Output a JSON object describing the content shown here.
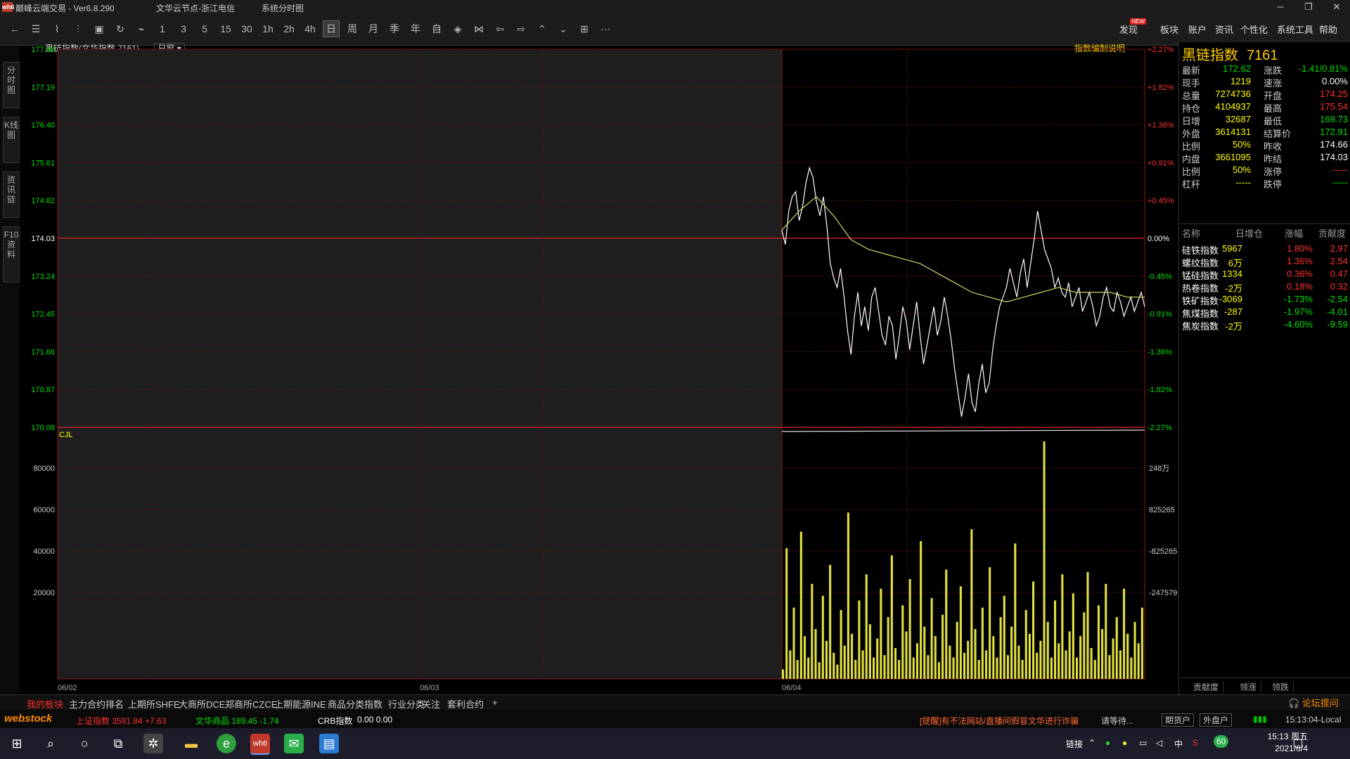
{
  "window": {
    "app_title": "巅峰云端交易 - Ver6.8.290",
    "server": "文华云节点-浙江电信",
    "mode": "系统分时图",
    "logo_text": "wh6"
  },
  "toolbar": {
    "period_buttons": [
      "1",
      "3",
      "5",
      "15",
      "30",
      "1h",
      "2h",
      "4h",
      "日",
      "周",
      "月",
      "季",
      "年",
      "自"
    ],
    "right_menu": [
      "发现",
      "板块",
      "账户",
      "资讯",
      "个性化",
      "系统工具",
      "帮助"
    ],
    "new_badge": "NEW"
  },
  "side_tabs": [
    "分时图",
    "K线图",
    "资讯链",
    "F10资料"
  ],
  "chart": {
    "header_title": "黑链指数(文华指数 7161)",
    "period_select": "日窗",
    "explain_link": "指数编制说明",
    "cjl_label": "CJL",
    "left_price_ticks": [
      "177.98",
      "177.19",
      "176.40",
      "175.61",
      "174.82",
      "174.03",
      "173.24",
      "172.45",
      "171.66",
      "170.87",
      "170.08"
    ],
    "right_pct_ticks": [
      "+2.27%",
      "+1.82%",
      "+1.36%",
      "+0.91%",
      "+0.45%",
      "0.00%",
      "-0.45%",
      "-0.91%",
      "-1.36%",
      "-1.82%",
      "-2.27%"
    ],
    "left_vol_ticks": [
      "80000",
      "60000",
      "40000",
      "20000"
    ],
    "right_vol_ticks": [
      "248万",
      "825265",
      "-825265",
      "-247579"
    ],
    "date_labels": [
      "06/02",
      "06/03",
      "06/04"
    ]
  },
  "chart_data": {
    "type": "line",
    "title": "黑链指数(文华指数 7161)",
    "prev_close": 174.03,
    "ylim": [
      170.08,
      177.98
    ],
    "series": [
      {
        "name": "price",
        "x": [
          0,
          4,
          8,
          12,
          16,
          20,
          24,
          28,
          32,
          36,
          40,
          44,
          48,
          52,
          56,
          60,
          64,
          68,
          72,
          76,
          80,
          84,
          88,
          92,
          96,
          100,
          104,
          108,
          112,
          116,
          120,
          124,
          128,
          132,
          136,
          140,
          144,
          148,
          152,
          156,
          160,
          164,
          168,
          172,
          176,
          180,
          184,
          188,
          192,
          196,
          200,
          204,
          208,
          212,
          216,
          220,
          224,
          228,
          232,
          236,
          240,
          244,
          248,
          252,
          256,
          260,
          264,
          268,
          272,
          276,
          280,
          284,
          288,
          292,
          296,
          300,
          304,
          308,
          312,
          316,
          320,
          324,
          328,
          332,
          336,
          340,
          344,
          348,
          352,
          356,
          360,
          364,
          368,
          372,
          376,
          380,
          384,
          388,
          392,
          396,
          400,
          404,
          408,
          412,
          416,
          420
        ],
        "values": [
          174.2,
          173.9,
          174.6,
          174.9,
          175.0,
          174.4,
          174.7,
          175.2,
          175.5,
          175.3,
          174.8,
          174.5,
          174.9,
          174.3,
          173.5,
          173.2,
          173.0,
          173.4,
          172.8,
          172.1,
          171.6,
          172.4,
          172.9,
          172.2,
          172.6,
          172.1,
          172.8,
          173.0,
          172.5,
          172.0,
          171.8,
          172.4,
          172.2,
          171.5,
          172.0,
          172.6,
          172.3,
          171.7,
          172.2,
          172.7,
          172.0,
          171.4,
          171.8,
          172.2,
          172.6,
          172.0,
          172.3,
          172.8,
          172.4,
          171.9,
          171.3,
          170.8,
          170.3,
          170.7,
          171.2,
          170.6,
          170.4,
          171.0,
          171.4,
          170.8,
          171.0,
          171.7,
          172.2,
          172.6,
          172.8,
          173.0,
          173.4,
          173.1,
          172.8,
          173.3,
          173.6,
          173.0,
          173.5,
          174.0,
          174.6,
          174.2,
          173.8,
          173.6,
          173.4,
          173.0,
          173.2,
          172.9,
          172.8,
          173.1,
          172.6,
          172.8,
          173.0,
          172.5,
          172.7,
          172.9,
          172.6,
          172.2,
          172.4,
          172.8,
          173.0,
          172.6,
          172.5,
          172.9,
          172.7,
          172.4,
          172.6,
          172.8,
          172.5,
          172.7,
          172.9,
          172.6
        ]
      },
      {
        "name": "average",
        "x": [
          0,
          20,
          40,
          60,
          80,
          100,
          120,
          140,
          160,
          180,
          200,
          220,
          240,
          260,
          280,
          300,
          320,
          340,
          360,
          380,
          400,
          420
        ],
        "values": [
          174.2,
          174.6,
          174.9,
          174.5,
          174.0,
          173.8,
          173.7,
          173.6,
          173.5,
          173.3,
          173.1,
          172.9,
          172.8,
          172.7,
          172.8,
          172.9,
          173.0,
          172.9,
          172.9,
          172.9,
          172.8,
          172.8
        ]
      }
    ],
    "volume": [
      4,
      55,
      12,
      30,
      8,
      62,
      18,
      9,
      40,
      21,
      7,
      35,
      16,
      48,
      11,
      6,
      29,
      14,
      70,
      19,
      8,
      33,
      12,
      44,
      23,
      9,
      17,
      38,
      10,
      26,
      52,
      13,
      8,
      31,
      20,
      42,
      9,
      15,
      58,
      22,
      10,
      34,
      18,
      7,
      27,
      46,
      14,
      9,
      24,
      39,
      11,
      16,
      63,
      21,
      8,
      30,
      12,
      47,
      18,
      9,
      26,
      35,
      10,
      22,
      57,
      14,
      8,
      29,
      19,
      41,
      11,
      16,
      100,
      24,
      9,
      33,
      15,
      44,
      12,
      20,
      36,
      9,
      18,
      28,
      45,
      13,
      8,
      31,
      21,
      40,
      10,
      17,
      26,
      12,
      38,
      19,
      9,
      24,
      15,
      30
    ]
  },
  "quote": {
    "name": "黑链指数",
    "code": "7161",
    "rows": [
      {
        "l1": "最新",
        "v1": "172.62",
        "c1": "grn",
        "l2": "涨跌",
        "v2": "-1.41/0.81%",
        "c2": "grn"
      },
      {
        "l1": "现手",
        "v1": "1219",
        "c1": "yel",
        "l2": "速涨",
        "v2": "0.00%",
        "c2": "wht"
      },
      {
        "l1": "总量",
        "v1": "7274736",
        "c1": "yel",
        "l2": "开盘",
        "v2": "174.25",
        "c2": "red"
      },
      {
        "l1": "持仓",
        "v1": "4104937",
        "c1": "yel",
        "l2": "最高",
        "v2": "175.54",
        "c2": "red"
      },
      {
        "l1": "日增",
        "v1": "32687",
        "c1": "yel",
        "l2": "最低",
        "v2": "169.73",
        "c2": "grn"
      },
      {
        "l1": "外盘",
        "v1": "3614131",
        "c1": "yel",
        "l2": "结算价",
        "v2": "172.91",
        "c2": "grn"
      },
      {
        "l1": "比例",
        "v1": "50%",
        "c1": "yel",
        "l2": "昨收",
        "v2": "174.66",
        "c2": "wht"
      },
      {
        "l1": "内盘",
        "v1": "3661095",
        "c1": "yel",
        "l2": "昨结",
        "v2": "174.03",
        "c2": "wht"
      },
      {
        "l1": "比例",
        "v1": "50%",
        "c1": "yel",
        "l2": "涨停",
        "v2": "-----",
        "c2": "red"
      },
      {
        "l1": "杠杆",
        "v1": "-----",
        "c1": "yel",
        "l2": "跌停",
        "v2": "-----",
        "c2": "grn"
      }
    ]
  },
  "sectors": {
    "headers": [
      "名称",
      "日增仓",
      "涨幅",
      "贡献度"
    ],
    "rows": [
      {
        "name": "硅铁指数",
        "inc": "5967",
        "pct": "1.80%",
        "pc": "red",
        "contrib": "2.97",
        "cc": "red"
      },
      {
        "name": "螺纹指数",
        "inc": "6万",
        "pct": "1.36%",
        "pc": "red",
        "contrib": "2.54",
        "cc": "red"
      },
      {
        "name": "锰硅指数",
        "inc": "1334",
        "pct": "0.36%",
        "pc": "red",
        "contrib": "0.47",
        "cc": "red"
      },
      {
        "name": "热卷指数",
        "inc": "-2万",
        "pct": "0.18%",
        "pc": "red",
        "contrib": "0.32",
        "cc": "red"
      },
      {
        "name": "铁矿指数",
        "inc": "-3069",
        "pct": "-1.73%",
        "pc": "grn",
        "contrib": "-2.54",
        "cc": "grn"
      },
      {
        "name": "焦煤指数",
        "inc": "-287",
        "pct": "-1.97%",
        "pc": "grn",
        "contrib": "-4.01",
        "cc": "grn"
      },
      {
        "name": "焦炭指数",
        "inc": "-2万",
        "pct": "-4.60%",
        "pc": "grn",
        "contrib": "-9.59",
        "cc": "grn"
      }
    ],
    "tabs": [
      "贡献度",
      "领涨",
      "领跌"
    ]
  },
  "bottom_tabs": [
    "我的板块",
    "主力合约排名",
    "上期所SHFE",
    "大商所DCE",
    "郑商所CZCE",
    "上期能源INE",
    "商品分类指数",
    "行业分类",
    "关注",
    "套利合约",
    "+"
  ],
  "status": {
    "brand": "webstock",
    "sh_index": "上证指数 3591.84 +7.63",
    "wh_index": "文华商品 189.45 -1.74",
    "crb_label": "CRB指数",
    "crb_value": "0.00 0.00",
    "notice": "[提醒]有不法网站/直播间假冒文华进行诈骗",
    "waiting": "请等待...",
    "account_btn": "期货户",
    "outer_btn": "外盘户",
    "time": "15:13:04-Local",
    "forum": "论坛提问"
  },
  "taskbar": {
    "tray_link": "链接",
    "ime": "中",
    "battery": "60",
    "clock_time": "15:13 周五",
    "clock_date": "2021/6/4"
  }
}
